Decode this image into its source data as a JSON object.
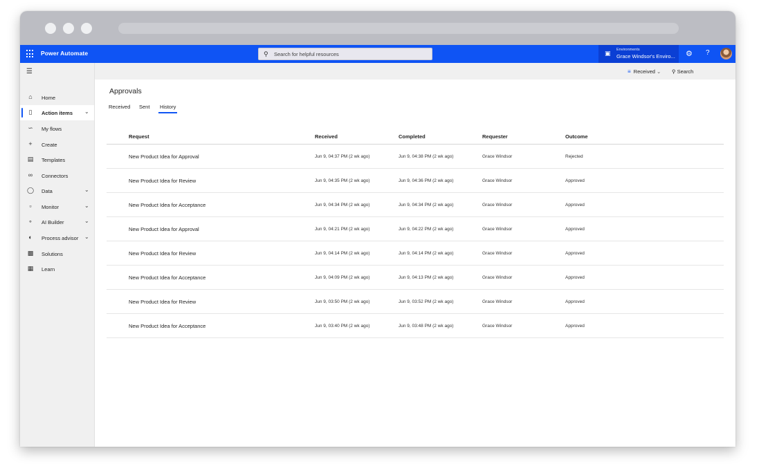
{
  "app": {
    "name": "Power Automate",
    "search_placeholder": "Search for helpful resources",
    "environment_label": "Environments",
    "environment_name": "Grace Windsor's Enviro..."
  },
  "sidebar": {
    "items": [
      {
        "label": "Home",
        "icon": "home-icon"
      },
      {
        "label": "Action items",
        "icon": "clipboard-icon",
        "active": true,
        "expandable": true
      },
      {
        "label": "My flows",
        "icon": "flow-icon"
      },
      {
        "label": "Create",
        "icon": "plus-icon"
      },
      {
        "label": "Templates",
        "icon": "templates-icon"
      },
      {
        "label": "Connectors",
        "icon": "connector-icon"
      },
      {
        "label": "Data",
        "icon": "database-icon",
        "expandable": true
      },
      {
        "label": "Monitor",
        "icon": "monitor-icon",
        "expandable": true
      },
      {
        "label": "AI Builder",
        "icon": "ai-builder-icon",
        "expandable": true
      },
      {
        "label": "Process advisor",
        "icon": "process-advisor-icon",
        "expandable": true
      },
      {
        "label": "Solutions",
        "icon": "solutions-icon"
      },
      {
        "label": "Learn",
        "icon": "book-icon"
      }
    ]
  },
  "commandbar": {
    "filter_label": "Received",
    "search_label": "Search"
  },
  "page": {
    "title": "Approvals",
    "tabs": [
      {
        "label": "Received"
      },
      {
        "label": "Sent"
      },
      {
        "label": "History",
        "selected": true
      }
    ]
  },
  "table": {
    "columns": [
      "Request",
      "Received",
      "Completed",
      "Requester",
      "Outcome"
    ],
    "rows": [
      {
        "request": "New Product Idea for Approval",
        "received": "Jun 9, 04:37 PM (2 wk ago)",
        "completed": "Jun 9, 04:38 PM (2 wk ago)",
        "requester": "Grace Windsor",
        "outcome": "Rejected"
      },
      {
        "request": "New Product Idea for Review",
        "received": "Jun 9, 04:35 PM (2 wk ago)",
        "completed": "Jun 9, 04:36 PM (2 wk ago)",
        "requester": "Grace Windsor",
        "outcome": "Approved"
      },
      {
        "request": "New Product Idea for Acceptance",
        "received": "Jun 9, 04:34 PM (2 wk ago)",
        "completed": "Jun 9, 04:34 PM (2 wk ago)",
        "requester": "Grace Windsor",
        "outcome": "Approved"
      },
      {
        "request": "New Product Idea for Approval",
        "received": "Jun 9, 04:21 PM (2 wk ago)",
        "completed": "Jun 9, 04:22 PM (2 wk ago)",
        "requester": "Grace Windsor",
        "outcome": "Approved"
      },
      {
        "request": "New Product Idea for Review",
        "received": "Jun 9, 04:14 PM (2 wk ago)",
        "completed": "Jun 9, 04:14 PM (2 wk ago)",
        "requester": "Grace Windsor",
        "outcome": "Approved"
      },
      {
        "request": "New Product Idea for Acceptance",
        "received": "Jun 9, 04:09 PM (2 wk ago)",
        "completed": "Jun 9, 04:13 PM (2 wk ago)",
        "requester": "Grace Windsor",
        "outcome": "Approved"
      },
      {
        "request": "New Product Idea for Review",
        "received": "Jun 9, 03:50 PM (2 wk ago)",
        "completed": "Jun 9, 03:52 PM (2 wk ago)",
        "requester": "Grace Windsor",
        "outcome": "Approved"
      },
      {
        "request": "New Product Idea for Acceptance",
        "received": "Jun 9, 03:40 PM (2 wk ago)",
        "completed": "Jun 9, 03:48 PM (2 wk ago)",
        "requester": "Grace Windsor",
        "outcome": "Approved"
      }
    ]
  },
  "colors": {
    "accent": "#0f54f4",
    "sidebar_bg": "#f0f0f0"
  }
}
